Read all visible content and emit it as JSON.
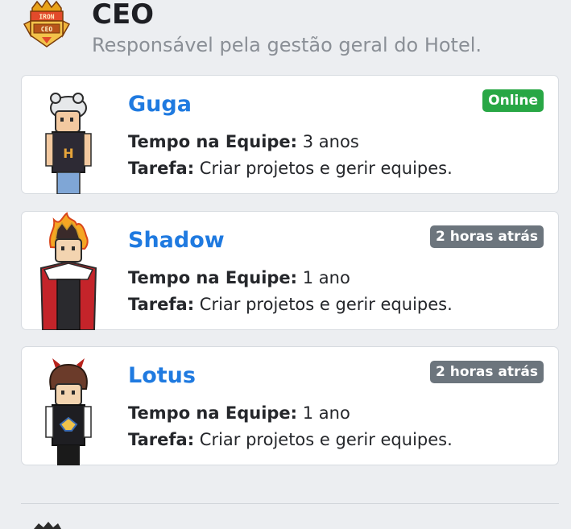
{
  "section": {
    "title": "CEO",
    "description": "Responsável pela gestão geral do Hotel.",
    "badge_icon": "iron-ceo-badge-icon",
    "badge_text_top": "IRON",
    "badge_text_bottom": "CEO"
  },
  "labels": {
    "time_label": "Tempo na Equipe:",
    "task_label": "Tarefa:"
  },
  "members": [
    {
      "name": "Guga",
      "status": "Online",
      "status_color": "#28a745",
      "time": "3 anos",
      "task": "Criar projetos e gerir equipes.",
      "avatar_icon": "habbo-avatar-cap-icon"
    },
    {
      "name": "Shadow",
      "status": "2 horas atrás",
      "status_color": "#6c757d",
      "time": "1 ano",
      "task": "Criar projetos e gerir equipes.",
      "avatar_icon": "habbo-avatar-flame-crown-icon"
    },
    {
      "name": "Lotus",
      "status": "2 horas atrás",
      "status_color": "#6c757d",
      "time": "1 ano",
      "task": "Criar projetos e gerir equipes.",
      "avatar_icon": "habbo-avatar-horns-icon"
    }
  ],
  "colors": {
    "background": "#eceef1",
    "name_link": "#1f7ae0",
    "online": "#28a745",
    "offline": "#6c757d"
  }
}
